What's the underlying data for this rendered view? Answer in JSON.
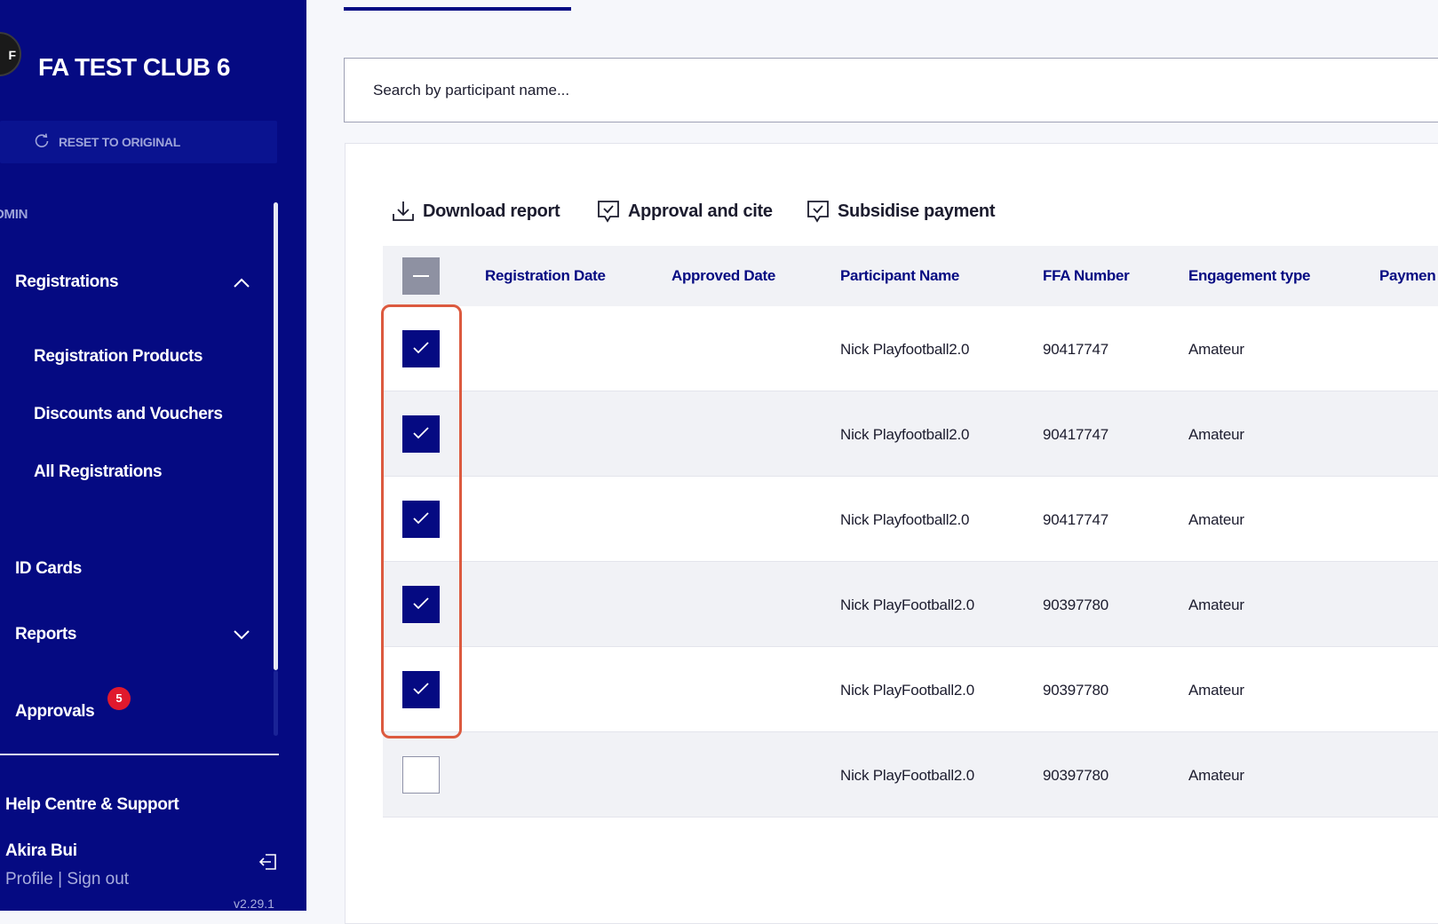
{
  "sidebar": {
    "club_name": "FA TEST CLUB 6",
    "logo_letter": "F",
    "reset_label": "RESET TO ORIGINAL",
    "section_label": "DMIN",
    "nav": {
      "registrations": "Registrations",
      "registration_products": "Registration Products",
      "discounts": "Discounts and Vouchers",
      "all_registrations": "All Registrations",
      "id_cards": "ID Cards",
      "reports": "Reports",
      "approvals": "Approvals",
      "approvals_badge": "5"
    },
    "help": "Help Centre & Support",
    "user_name": "Akira Bui",
    "profile_label": "Profile",
    "separator": " | ",
    "signout_label": "Sign out",
    "version": "v2.29.1"
  },
  "search": {
    "placeholder": "Search by participant name..."
  },
  "toolbar": {
    "download": "Download report",
    "approval": "Approval and cite",
    "subsidise": "Subsidise payment"
  },
  "table": {
    "columns": {
      "registration_date": "Registration Date",
      "approved_date": "Approved Date",
      "participant_name": "Participant Name",
      "ffa_number": "FFA Number",
      "engagement_type": "Engagement type",
      "payment": "Paymen"
    },
    "rows": [
      {
        "name": "Nick Playfootball2.0",
        "ffa": "90417747",
        "type": "Amateur",
        "checked": true
      },
      {
        "name": "Nick Playfootball2.0",
        "ffa": "90417747",
        "type": "Amateur",
        "checked": true
      },
      {
        "name": "Nick Playfootball2.0",
        "ffa": "90417747",
        "type": "Amateur",
        "checked": true
      },
      {
        "name": "Nick PlayFootball2.0",
        "ffa": "90397780",
        "type": "Amateur",
        "checked": true
      },
      {
        "name": "Nick PlayFootball2.0",
        "ffa": "90397780",
        "type": "Amateur",
        "checked": true
      },
      {
        "name": "Nick PlayFootball2.0",
        "ffa": "90397780",
        "type": "Amateur",
        "checked": false
      }
    ]
  },
  "colors": {
    "brand": "#050a82",
    "badge": "#e0192d",
    "highlight": "#dc5a3f"
  }
}
